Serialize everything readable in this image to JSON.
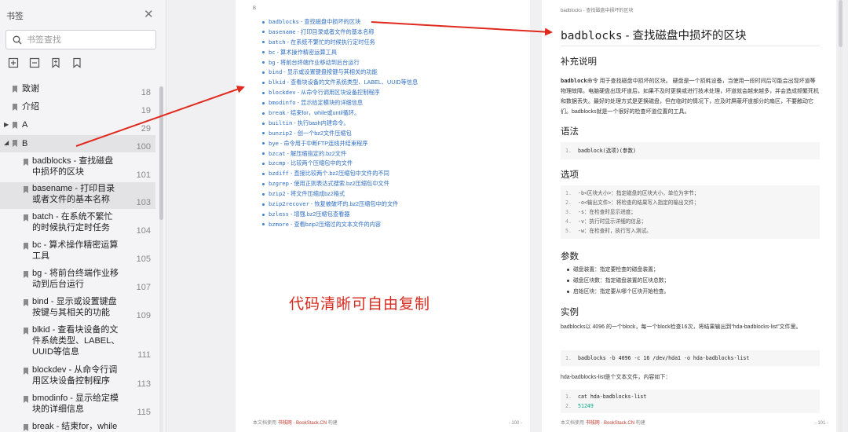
{
  "sidebar": {
    "title": "书签",
    "search_placeholder": "书签查找",
    "toc": [
      {
        "label": "致谢",
        "page": "18"
      },
      {
        "label": "介绍",
        "page": "19"
      },
      {
        "label": "A",
        "page": "29"
      },
      {
        "label": "B",
        "page": "100"
      },
      {
        "label": "badblocks - 查找磁盘中损坏的区块",
        "page": "101"
      },
      {
        "label": "basename - 打印目录或者文件的基本名称",
        "page": "103"
      },
      {
        "label": "batch - 在系统不繁忙的时候执行定时任务",
        "page": "104"
      },
      {
        "label": "bc - 算术操作精密运算工具",
        "page": "105"
      },
      {
        "label": "bg - 将前台终端作业移动到后台运行",
        "page": "107"
      },
      {
        "label": "bind - 显示或设置键盘按键与其相关的功能",
        "page": "109"
      },
      {
        "label": "blkid - 查看块设备的文件系统类型、LABEL、UUID等信息",
        "page": "111"
      },
      {
        "label": "blockdev - 从命令行调用区块设备控制程序",
        "page": "113"
      },
      {
        "label": "bmodinfo - 显示给定模块的详细信息",
        "page": "115"
      },
      {
        "label": "break - 结束for，while",
        "page": ""
      }
    ]
  },
  "page1": {
    "header": "B",
    "commands": [
      {
        "cmd": "badblocks",
        "desc": "查找磁盘中损坏的区块"
      },
      {
        "cmd": "basename",
        "desc": "打印目录或者文件的基本名称"
      },
      {
        "cmd": "batch",
        "desc": "在系统不繁忙的时候执行定时任务"
      },
      {
        "cmd": "bc",
        "desc": "算术操作精密运算工具"
      },
      {
        "cmd": "bg",
        "desc": "将前台终端作业移动到后台运行"
      },
      {
        "cmd": "bind",
        "desc": "显示或设置键盘按键与其相关的功能"
      },
      {
        "cmd": "blkid",
        "desc": "查看块设备的文件系统类型、LABEL、UUID等信息"
      },
      {
        "cmd": "blockdev",
        "desc": "从命令行调用区块设备控制程序"
      },
      {
        "cmd": "bmodinfo",
        "desc": "显示给定模块的详细信息"
      },
      {
        "cmd": "break",
        "desc": "结束for，while或until循环。"
      },
      {
        "cmd": "builtin",
        "desc": "执行bash内建命令。"
      },
      {
        "cmd": "bunzip2",
        "desc": "创一个bz2文件压缩包"
      },
      {
        "cmd": "bye",
        "desc": "命令用于中断FTP连线并结束程序"
      },
      {
        "cmd": "bzcat",
        "desc": "解压缩指定的.bz2文件"
      },
      {
        "cmd": "bzcmp",
        "desc": "比较两个压缩包中的文件"
      },
      {
        "cmd": "bzdiff",
        "desc": "直接比较两个.bz2压缩包中文件的不同"
      },
      {
        "cmd": "bzgrep",
        "desc": "使用正则表达式搜索.bz2压缩包中文件"
      },
      {
        "cmd": "bzip2",
        "desc": "将文件压缩成bz2格式"
      },
      {
        "cmd": "bzip2recover",
        "desc": "恢复被破坏的.bz2压缩包中的文件"
      },
      {
        "cmd": "bzless",
        "desc": "增强.bz2压缩包查看器"
      },
      {
        "cmd": "bzmore",
        "desc": "查看bzip2压缩过的文本文件的内容"
      }
    ],
    "overlay": "代码清晰可自由复制",
    "footer_prefix": "本文档使用",
    "footer_link": "书栈网 · BookStack.CN",
    "footer_suffix": "构建",
    "page_num": "- 100 -"
  },
  "page2": {
    "header": "badblocks - 查找磁盘中损坏的区块",
    "title_cmd": "badblocks",
    "title_desc": " - 查找磁盘中损坏的区块",
    "sec_supp": "补充说明",
    "supp_bold": "badblock",
    "supp_text": "命令 用于查找磁盘中损坏的区块。 硬盘是一个损耗设备，当使用一段时间后可能会出现坏道等物理故障。电脑硬盘出现坏道后，如果不及时更换或进行技术处理，坏道就会越来越多，并会造成频繁死机和数据丢失。最好的处理方式是更换磁盘，但在临时的情况下，应及时屏蔽坏道部分的扇区，不要触动它们。badblocks就是一个很好的检查坏道位置的工具。",
    "sec_syntax": "语法",
    "syntax": "badblock(选项)(参数)",
    "sec_options": "选项",
    "options": [
      "-b<区块大小>：指定磁盘的区块大小，单位为字节；",
      "-o<输出文件>：将检查的结果写入指定的输出文件；",
      "-s：在检查时显示进度；",
      "-v：执行时显示详细的信息；",
      "-w：在检查时，执行写入测试。"
    ],
    "sec_params": "参数",
    "params": [
      "磁盘装置：指定要检查的磁盘装置；",
      "磁盘区块数：指定磁盘装置的区块总数；",
      "启始区块：指定要从哪个区块开始检查。"
    ],
    "sec_example": "实例",
    "example_text": "badblocks以 4096 的一个block，每一个block检查16次，将结果输出到“hda-badblocks-list”文件里。",
    "example_code": "badblocks -b 4096 -c 16 /dev/hda1 -o hda-badblocks-list",
    "example_text2": "hda-badblocks-list是个文本文件，内容如下：",
    "example_code2": [
      "cat hda-badblocks-list",
      "51249"
    ],
    "footer_prefix": "本文档使用",
    "footer_link": "书栈网 · BookStack.CN",
    "footer_suffix": "构建",
    "page_num": "- 101 -"
  },
  "colors": {
    "accent": "#2f6fc4",
    "arrow": "#e02a1e",
    "overlay": "#d72a1e"
  }
}
